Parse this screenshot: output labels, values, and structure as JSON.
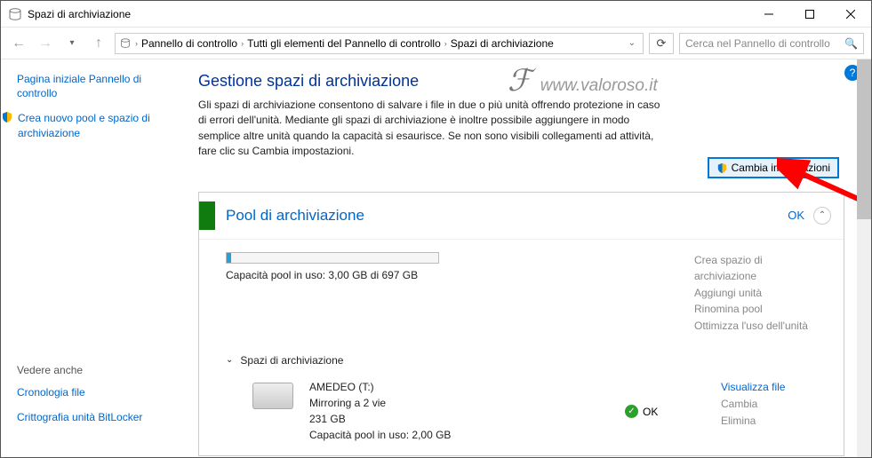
{
  "window": {
    "title": "Spazi di archiviazione"
  },
  "breadcrumb": {
    "items": [
      "Pannello di controllo",
      "Tutti gli elementi del Pannello di controllo",
      "Spazi di archiviazione"
    ]
  },
  "search": {
    "placeholder": "Cerca nel Pannello di controllo"
  },
  "sidebar": {
    "home": "Pagina iniziale Pannello di controllo",
    "create": "Crea nuovo pool e spazio di archiviazione",
    "seealso_label": "Vedere anche",
    "history": "Cronologia file",
    "bitlocker": "Crittografia unità BitLocker"
  },
  "main": {
    "heading": "Gestione spazi di archiviazione",
    "description": "Gli spazi di archiviazione consentono di salvare i file in due o più unità offrendo protezione in caso di errori dell'unità. Mediante gli spazi di archiviazione è inoltre possibile aggiungere in modo semplice altre unità quando la capacità si esaurisce. Se non sono visibili collegamenti ad attività, fare clic su Cambia impostazioni.",
    "change_btn": "Cambia impostazioni"
  },
  "pool": {
    "title": "Pool di archiviazione",
    "status": "OK",
    "capacity": "Capacità pool in uso: 3,00 GB di 697 GB",
    "actions": {
      "create": "Crea spazio di archiviazione",
      "add": "Aggiungi unità",
      "rename": "Rinomina pool",
      "optimize": "Ottimizza l'uso dell'unità"
    }
  },
  "spaces": {
    "header": "Spazi di archiviazione",
    "item": {
      "name": "AMEDEO (T:)",
      "type": "Mirroring a 2 vie",
      "size": "231 GB",
      "usage": "Capacità pool in uso: 2,00 GB",
      "status": "OK",
      "actions": {
        "view": "Visualizza file",
        "change": "Cambia",
        "delete": "Elimina"
      }
    }
  },
  "watermark": "www.valoroso.it"
}
